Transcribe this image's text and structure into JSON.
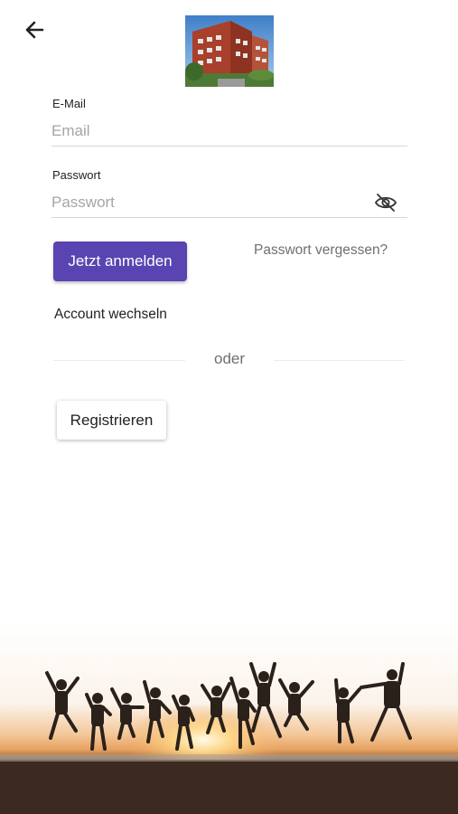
{
  "header": {
    "back_icon": "arrow-left-icon",
    "logo": "building-photo"
  },
  "email": {
    "label": "E-Mail",
    "value": "",
    "placeholder": "Email"
  },
  "password": {
    "label": "Passwort",
    "value": "",
    "placeholder": "Passwort",
    "visibility_icon": "eye-off-icon"
  },
  "actions": {
    "login_label": "Jetzt anmelden",
    "forgot_label": "Passwort vergessen?",
    "switch_account_label": "Account wechseln",
    "divider_label": "oder",
    "register_label": "Registrieren"
  },
  "colors": {
    "primary": "#5a44b1",
    "text": "#222222",
    "muted": "#6f6f6f",
    "placeholder": "#a6a6a6"
  }
}
